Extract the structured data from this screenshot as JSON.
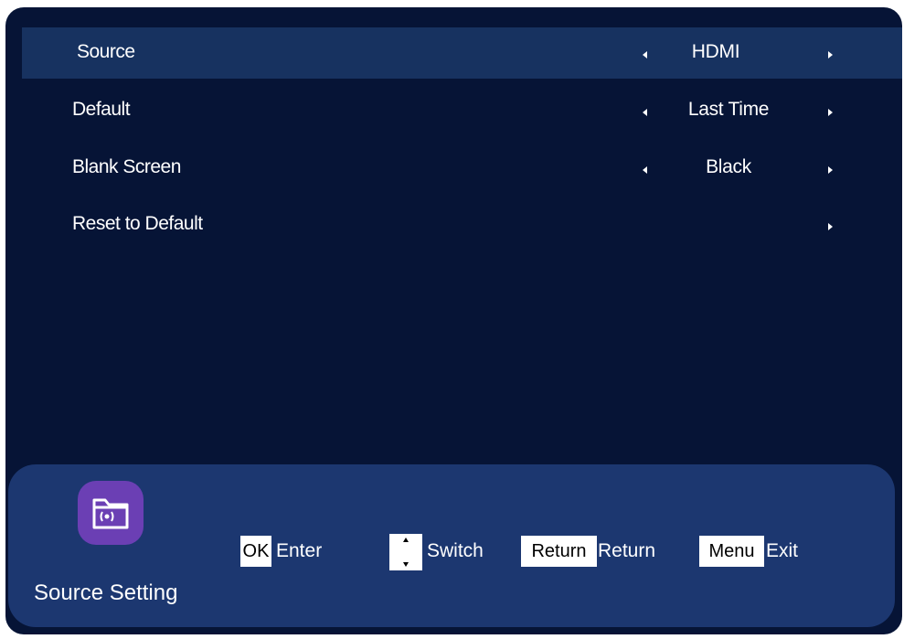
{
  "menu": {
    "items": [
      {
        "label": "Source",
        "value": "HDMI",
        "has_left_arrow": true,
        "has_right_arrow": true,
        "selected": true
      },
      {
        "label": "Default",
        "value": "Last Time",
        "has_left_arrow": true,
        "has_right_arrow": true,
        "selected": false
      },
      {
        "label": "Blank Screen",
        "value": "Black",
        "has_left_arrow": true,
        "has_right_arrow": true,
        "selected": false
      },
      {
        "label": "Reset to Default",
        "value": "",
        "has_left_arrow": false,
        "has_right_arrow": true,
        "selected": false
      }
    ]
  },
  "footer": {
    "title": "Source Setting",
    "icon": "source-folder-icon",
    "keys": {
      "ok_key": "OK",
      "ok_action": "Enter",
      "switch_key_icon": "up-down-arrows-icon",
      "switch_action": "Switch",
      "return_key": "Return",
      "return_action": "Return",
      "menu_key": "Menu",
      "menu_action": "Exit"
    }
  },
  "colors": {
    "background": "#061436",
    "selected_row": "#173260",
    "footer_panel": "#1c3770",
    "icon_tile": "#6b3fb4",
    "text": "#ffffff"
  }
}
